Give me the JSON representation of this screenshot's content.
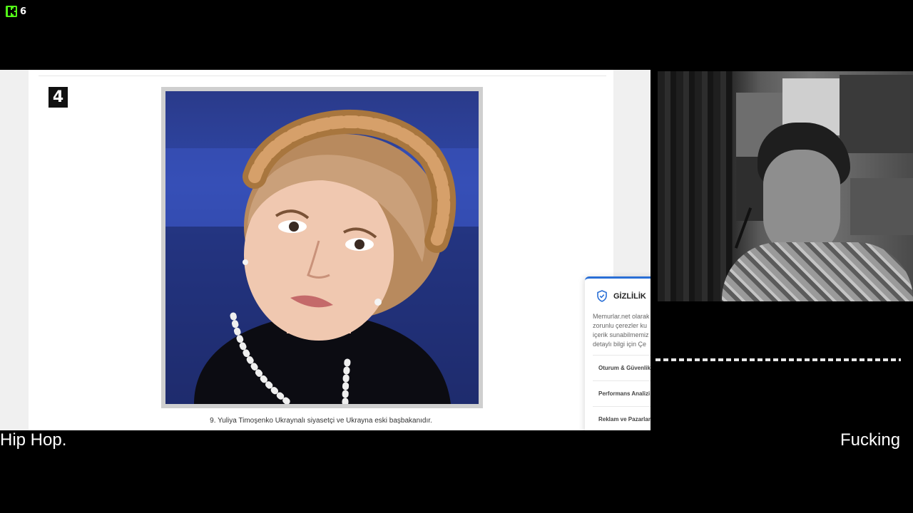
{
  "overlay": {
    "badge_count": "6",
    "brand_color": "#53fc18"
  },
  "article": {
    "item_number": "4",
    "caption": "9. Yuliya Timoşenko Ukraynalı siyasetçi ve Ukrayna eski başbakanıdır."
  },
  "privacy_panel": {
    "title": "GİZLİLİK",
    "text_lines": [
      "Memurlar.net olarak",
      "zorunlu çerezler ku",
      "içerik sunabilmemiz",
      "detaylı bilgi için Çe"
    ],
    "options": [
      "Oturum & Güvenlik",
      "Performans Analizi",
      "Reklam ve Pazarlam"
    ],
    "accent_color": "#2a6fd6"
  },
  "subtitles": {
    "left": "Hip Hop.",
    "right": "Fucking"
  }
}
